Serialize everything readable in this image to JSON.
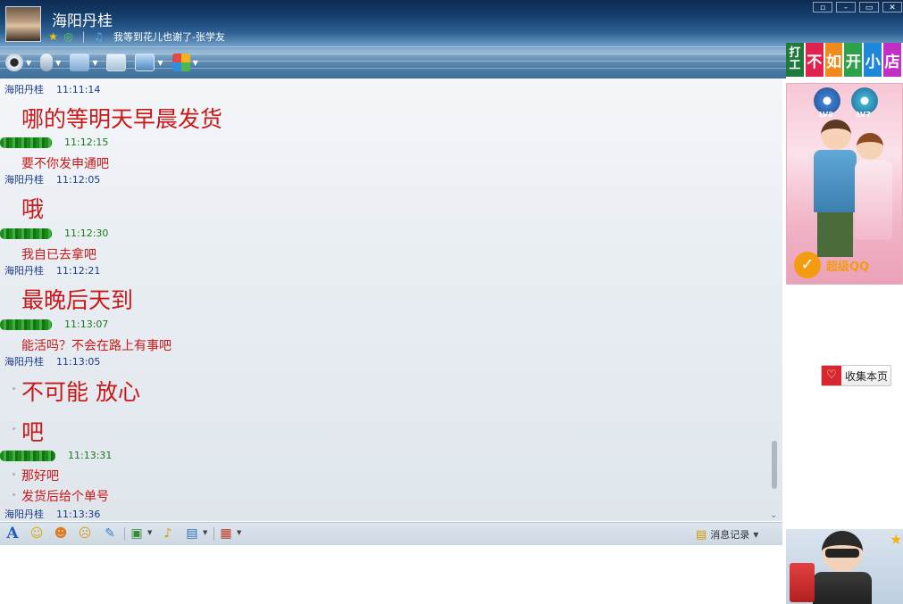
{
  "header": {
    "username": "海阳丹桂",
    "signature": "我等到花儿也谢了-张学友",
    "status_icons": [
      "star-icon",
      "qzone-icon",
      "music-icon"
    ]
  },
  "toolbar": {
    "buttons": [
      "video-call-icon",
      "voice-call-icon",
      "file-transfer-icon",
      "sms-icon",
      "remote-desktop-icon",
      "apps-icon"
    ]
  },
  "chat": {
    "messages": [
      {
        "sender": "海阳丹桂",
        "self": true,
        "time": "11:11:14",
        "lines": [
          "哪的等明天早晨发货"
        ],
        "size": "big"
      },
      {
        "sender": "",
        "self": false,
        "time": "11:12:15",
        "lines": [
          "要不你发申通吧"
        ],
        "size": "small"
      },
      {
        "sender": "海阳丹桂",
        "self": true,
        "time": "11:12:05",
        "lines": [
          "哦"
        ],
        "size": "big"
      },
      {
        "sender": "",
        "self": false,
        "time": "11:12:30",
        "lines": [
          "我自已去拿吧"
        ],
        "size": "small"
      },
      {
        "sender": "海阳丹桂",
        "self": true,
        "time": "11:12:21",
        "lines": [
          "最晚后天到"
        ],
        "size": "big"
      },
      {
        "sender": "",
        "self": false,
        "time": "11:13:07",
        "lines": [
          "能活吗？不会在路上有事吧"
        ],
        "size": "small"
      },
      {
        "sender": "海阳丹桂",
        "self": true,
        "time": "11:13:05",
        "lines": [
          "不可能 放心",
          "吧"
        ],
        "size": "big"
      },
      {
        "sender": "",
        "self": false,
        "time": "11:13:31",
        "lines": [
          "那好吧",
          "发货后给个单号"
        ],
        "size": "small"
      },
      {
        "sender": "海阳丹桂",
        "self": true,
        "time": "11:13:36",
        "lines": [],
        "size": "small"
      }
    ]
  },
  "input_toolbar": {
    "history_label": "消息记录"
  },
  "sidebar": {
    "ad_chars": [
      "打工",
      "不",
      "如",
      "开",
      "小",
      "店"
    ],
    "ad_colors": [
      "#1e7a3a",
      "#e0224f",
      "#f08a1e",
      "#2da24a",
      "#1e88d8",
      "#c22fc7"
    ],
    "favorite_label": "收集本页",
    "super_qq_label": "超级QQ",
    "badge_labels": [
      "LV8",
      "LV7"
    ]
  }
}
